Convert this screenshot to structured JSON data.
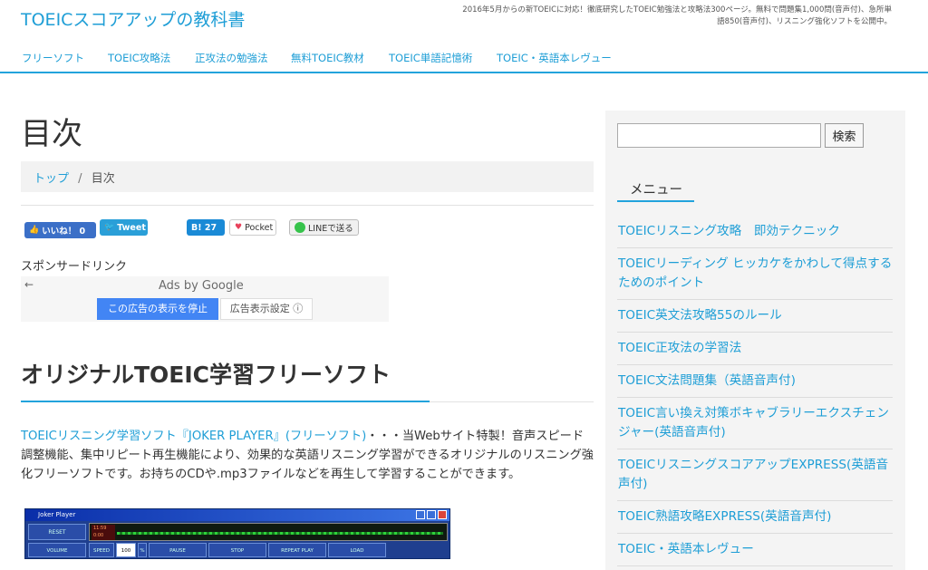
{
  "header": {
    "site_title": "TOEICスコアアップの教科書",
    "tagline": "2016年5月からの新TOEICに対応！徹底研究したTOEIC勉強法と攻略法300ページ。無料で問題集1,000問(音声付)、急所単語850(音声付)、リスニング強化ソフトを公開中。"
  },
  "nav": {
    "items": [
      {
        "label": "フリーソフト"
      },
      {
        "label": "TOEIC攻略法"
      },
      {
        "label": "正攻法の勉強法"
      },
      {
        "label": "無料TOEIC教材"
      },
      {
        "label": "TOEIC単語記憶術"
      },
      {
        "label": "TOEIC・英語本レヴュー"
      }
    ]
  },
  "main": {
    "page_title": "目次",
    "breadcrumb": {
      "home": "トップ",
      "separator": "/",
      "current": "目次"
    },
    "share": {
      "facebook": "いいね！ 0",
      "twitter": "Tweet",
      "hatena": "B! 27",
      "pocket": "Pocket",
      "line": "LINEで送る"
    },
    "sponsor_label": "スポンサードリンク",
    "ad": {
      "back_arrow": "←",
      "ads_by": "Ads by Google",
      "stop_button": "この広告の表示を停止",
      "settings_button": "広告表示設定 ⓘ"
    },
    "section_heading": "オリジナルTOEIC学習フリーソフト",
    "intro_link": "TOEICリスニング学習ソフト『JOKER PLAYER』(フリーソフト)",
    "intro_text": "・・・当Webサイト特製！音声スピード調整機能、集中リピート再生機能により、効果的な英語リスニング学習ができるオリジナルのリスニング強化フリーソフトです。お持ちのCDや.mp3ファイルなどを再生して学習することができます。",
    "player": {
      "title": "Joker Player",
      "reset": "RESET",
      "readout": "11:59 0:00",
      "volume": "VOLUME",
      "speed": "SPEED",
      "speed_value": "100",
      "percent": "%",
      "pause": "PAUSE",
      "stop": "STOP",
      "repeat": "REPEAT PLAY",
      "load": "LOAD"
    }
  },
  "sidebar": {
    "search_placeholder": "",
    "search_button": "検索",
    "menu_heading": "メニュー",
    "menu_items": [
      {
        "label": "TOEICリスニング攻略　即効テクニック"
      },
      {
        "label": "TOEICリーディング ヒッカケをかわして得点するためのポイント"
      },
      {
        "label": "TOEIC英文法攻略55のルール"
      },
      {
        "label": "TOEIC正攻法の学習法"
      },
      {
        "label": "TOEIC文法問題集（英語音声付)"
      },
      {
        "label": "TOEIC言い換え対策ボキャブラリーエクスチェンジャー(英語音声付)"
      },
      {
        "label": "TOEICリスニングスコアアップEXPRESS(英語音声付)"
      },
      {
        "label": "TOEIC熟語攻略EXPRESS(英語音声付)"
      },
      {
        "label": "TOEIC・英語本レヴュー"
      }
    ]
  },
  "colors": {
    "accent": "#1e9ed6",
    "nav_border": "#22a3dc",
    "ad_stop": "#4285f4"
  }
}
